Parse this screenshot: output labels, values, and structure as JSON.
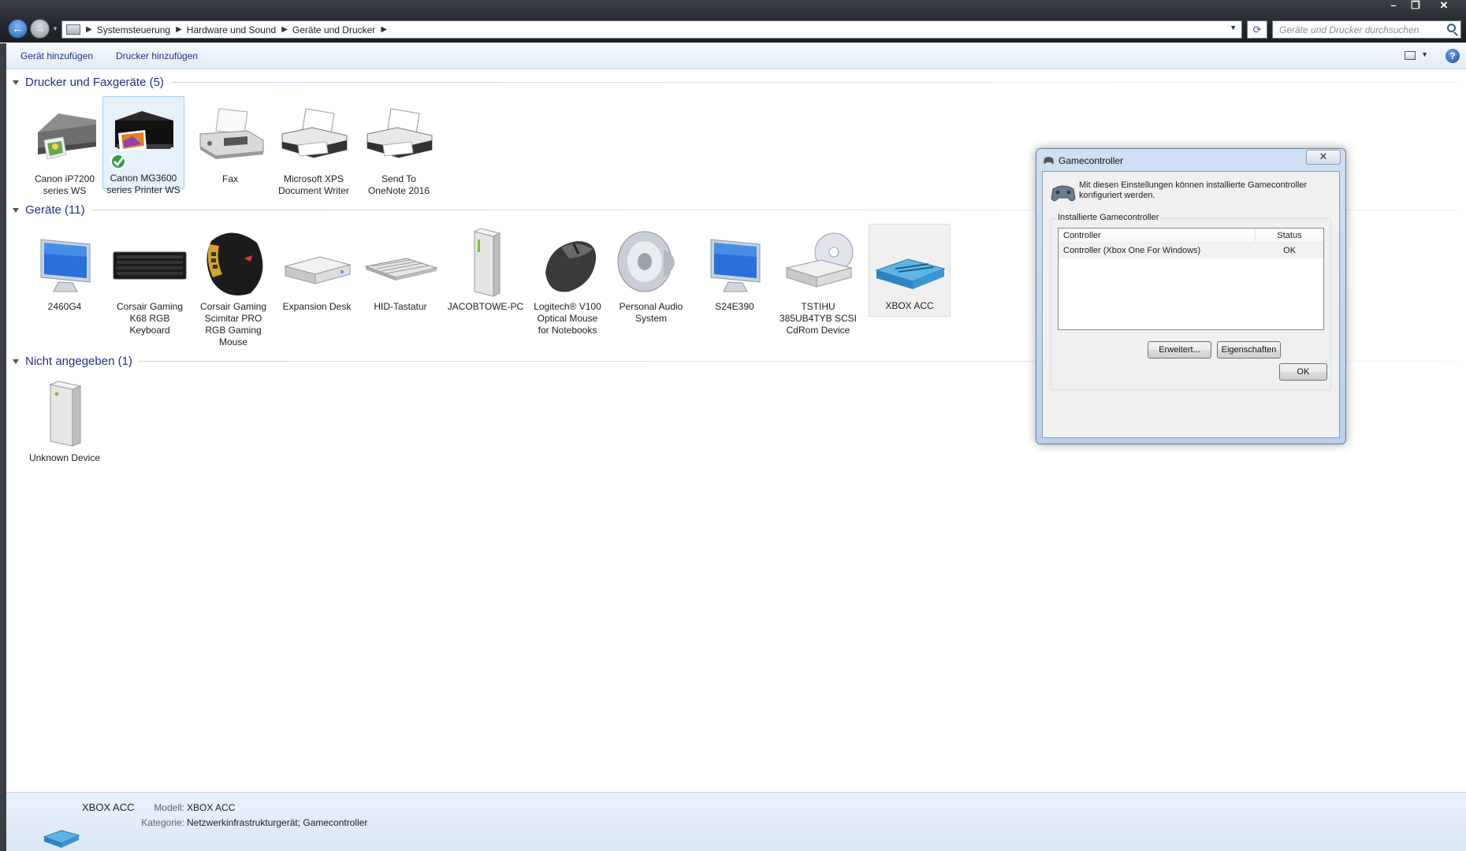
{
  "window": {
    "controls": {
      "minimize": "–",
      "maximize": "❐",
      "close": "✕"
    }
  },
  "address": {
    "crumbs": [
      "Systemsteuerung",
      "Hardware und Sound",
      "Geräte und Drucker"
    ],
    "search_placeholder": "Geräte und Drucker durchsuchen"
  },
  "toolbar": {
    "add_device": "Gerät hinzufügen",
    "add_printer": "Drucker hinzufügen"
  },
  "groups": {
    "printers": {
      "title": "Drucker und Faxgeräte (5)",
      "items": [
        {
          "label": "Canon iP7200\nseries WS",
          "icon": "printer-photo-icon"
        },
        {
          "label": "Canon MG3600\nseries Printer WS",
          "icon": "printer-default-icon",
          "default": true
        },
        {
          "label": "Fax",
          "icon": "fax-icon"
        },
        {
          "label": "Microsoft XPS\nDocument Writer",
          "icon": "printer-icon"
        },
        {
          "label": "Send To\nOneNote 2016",
          "icon": "printer-icon"
        }
      ]
    },
    "devices": {
      "title": "Geräte (11)",
      "items": [
        {
          "label": "2460G4",
          "icon": "monitor-icon"
        },
        {
          "label": "Corsair Gaming\nK68 RGB\nKeyboard",
          "icon": "keyboard-black-icon"
        },
        {
          "label": "Corsair Gaming\nScimitar PRO\nRGB Gaming\nMouse",
          "icon": "gaming-mouse-icon"
        },
        {
          "label": "Expansion Desk",
          "icon": "external-drive-icon"
        },
        {
          "label": "HID-Tastatur",
          "icon": "keyboard-icon"
        },
        {
          "label": "JACOBTOWE-PC",
          "icon": "computer-tower-icon"
        },
        {
          "label": "Logitech® V100\nOptical Mouse\nfor Notebooks",
          "icon": "mouse-icon"
        },
        {
          "label": "Personal Audio\nSystem",
          "icon": "speaker-icon"
        },
        {
          "label": "S24E390",
          "icon": "monitor-icon"
        },
        {
          "label": "TSTIHU\n385UB4TYB SCSI\nCdRom Device",
          "icon": "cdrom-icon"
        },
        {
          "label": "XBOX ACC",
          "icon": "router-icon"
        }
      ]
    },
    "unspecified": {
      "title": "Nicht angegeben (1)",
      "items": [
        {
          "label": "Unknown Device",
          "icon": "unknown-device-icon"
        }
      ]
    }
  },
  "details": {
    "name": "XBOX ACC",
    "model_key": "Modell:",
    "model_value": "XBOX ACC",
    "category_key": "Kategorie:",
    "category_value": "Netzwerkinfrastrukturgerät; Gamecontroller"
  },
  "dialog": {
    "title": "Gamecontroller",
    "close": "✕",
    "description": "Mit diesen Einstellungen können installierte Gamecontroller konfiguriert werden.",
    "group_label": "Installierte Gamecontroller",
    "columns": [
      "Controller",
      "Status"
    ],
    "rows": [
      {
        "controller": "Controller (Xbox One For Windows)",
        "status": "OK"
      }
    ],
    "advanced_button": "Erweitert...",
    "properties_button": "Eigenschaften",
    "ok_button": "OK"
  }
}
